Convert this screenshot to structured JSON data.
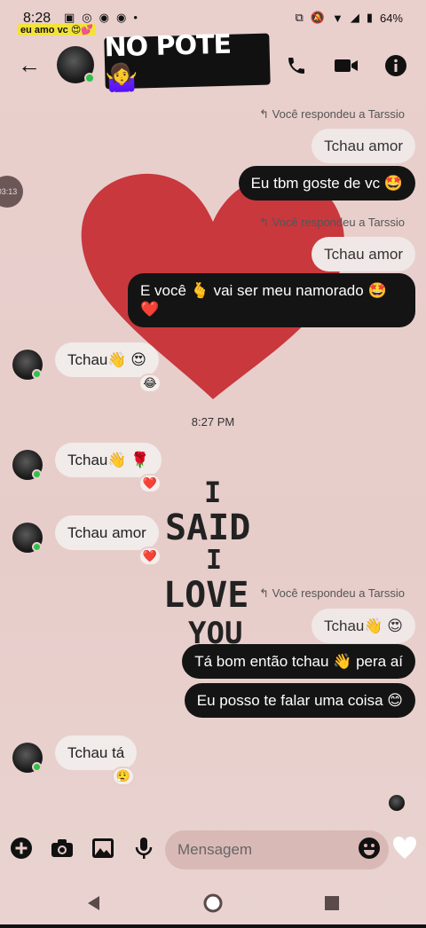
{
  "status": {
    "time": "8:28",
    "battery": "64%"
  },
  "overlay": {
    "label": "eu amo vc 😍💕"
  },
  "header": {
    "title": "NO POTE 🤷‍♀️"
  },
  "side_bubble": {
    "time": "03:13"
  },
  "drawing": {
    "line1": "I",
    "line2": "SAID",
    "line3": "I",
    "line4": "LOVE",
    "line5": "YOU"
  },
  "messages": {
    "reply1": "↰ Você respondeu a Tarssio",
    "quoted1": "Tchau amor",
    "out1": "Eu tbm goste de vc 🤩",
    "reply2": "↰ Você respondeu a Tarssio",
    "quoted2": "Tchau amor",
    "out2": "E você 🫰 vai ser meu namorado 🤩",
    "out2b": "❤️",
    "in1": "Tchau👋 😍",
    "in1_react": "😂",
    "time_sep": "8:27 PM",
    "in2": "Tchau👋 🌹",
    "in2_react": "❤️",
    "in3": "Tchau amor",
    "in3_react": "❤️",
    "reply3": "↰ Você respondeu a Tarssio",
    "quoted3": "Tchau👋 😍",
    "out3": "Tá bom então tchau 👋 pera aí",
    "out4": "Eu posso te falar uma coisa 😊",
    "in4": "Tchau tá",
    "in4_react": "😮‍💨"
  },
  "composer": {
    "placeholder": "Mensagem"
  }
}
